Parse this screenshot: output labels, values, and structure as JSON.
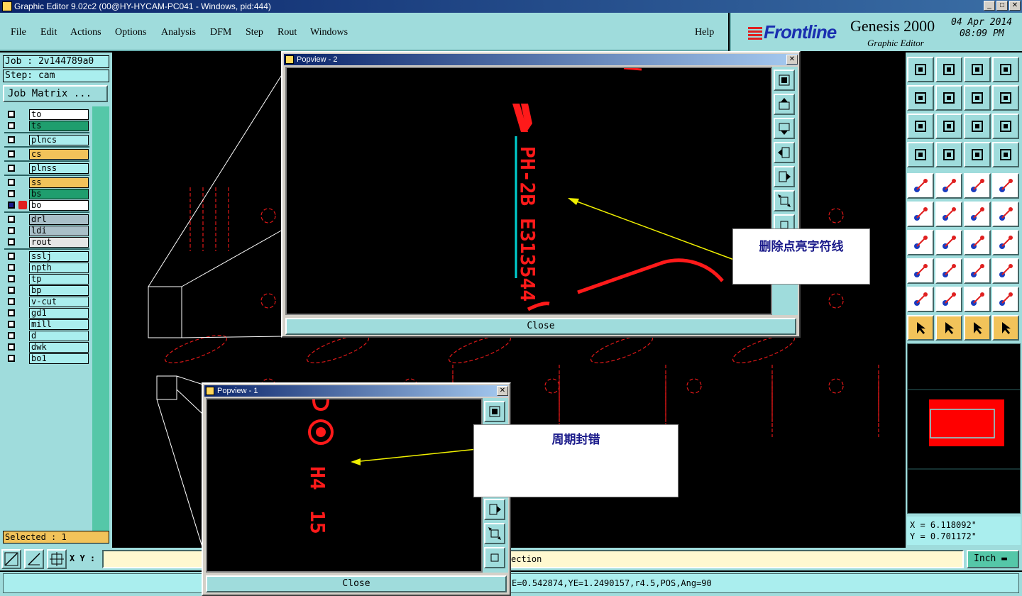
{
  "window": {
    "title": "Graphic Editor 9.02c2 (00@HY-HYCAM-PC041 - Windows, pid:444)",
    "buttons": [
      "_",
      "□",
      "✕"
    ]
  },
  "menu": {
    "items": [
      "File",
      "Edit",
      "Actions",
      "Options",
      "Analysis",
      "DFM",
      "Step",
      "Rout",
      "Windows"
    ],
    "help": "Help"
  },
  "brand": {
    "logo": "Frontline",
    "product": "Genesis 2000",
    "subtitle": "Graphic Editor",
    "date": "04 Apr 2014",
    "time": "08:09 PM"
  },
  "job": {
    "job_label": "Job : 2v144789a0",
    "step_label": "Step: cam",
    "matrix_button": "Job Matrix ..."
  },
  "layers": [
    {
      "name": "to",
      "color": "#ffffff"
    },
    {
      "name": "ts",
      "color": "#1f9e6e"
    },
    {
      "name": "plncs",
      "color": "#aee"
    },
    {
      "name": "cs",
      "color": "#f2c35a"
    },
    {
      "name": "plnss",
      "color": "#aee"
    },
    {
      "name": "ss",
      "color": "#f2c35a"
    },
    {
      "name": "bs",
      "color": "#1f9e6e"
    },
    {
      "name": "bo",
      "color": "#ffffff"
    },
    {
      "name": "drl",
      "color": "#a9bfc8"
    },
    {
      "name": "ldi",
      "color": "#a9bfc8"
    },
    {
      "name": "rout",
      "color": "#e6e6e6"
    },
    {
      "name": "sslj",
      "color": "#aee"
    },
    {
      "name": "npth",
      "color": "#aee"
    },
    {
      "name": "tp",
      "color": "#aee"
    },
    {
      "name": "bp",
      "color": "#aee"
    },
    {
      "name": "v-cut",
      "color": "#aee"
    },
    {
      "name": "gd1",
      "color": "#aee"
    },
    {
      "name": "mill",
      "color": "#aee"
    },
    {
      "name": "d",
      "color": "#aee"
    },
    {
      "name": "dwk",
      "color": "#aee"
    },
    {
      "name": "bo1",
      "color": "#aee"
    }
  ],
  "selected_label": "Selected : 1",
  "bottom": {
    "xy_label": "X Y :",
    "xy_value": "",
    "prompt_text": "ection",
    "unit": "Inch",
    "status": "E=0.542874,YE=1.2490157,r4.5,POS,Ang=90"
  },
  "coords": {
    "x": "X = 6.118092\"",
    "y": "Y = 0.701172\""
  },
  "popview2": {
    "title": "Popview - 2",
    "close_label": "Close",
    "text": "PH-2B E313544"
  },
  "popview1": {
    "title": "Popview - 1",
    "close_label": "Close",
    "text1": "H4",
    "text2": "15"
  },
  "annotations": {
    "note1": "删除点亮字符线",
    "note2": "周期封错"
  },
  "colors": {
    "panel": "#9fdcdc",
    "accent": "#f2c35a",
    "trace": "#ff1a1a",
    "arrow": "#f0f000"
  }
}
